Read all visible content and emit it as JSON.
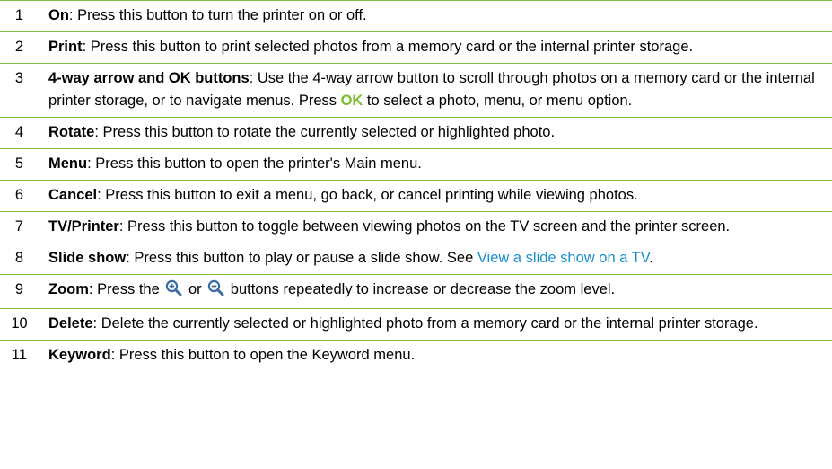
{
  "rows": [
    {
      "num": "1",
      "term": "On",
      "text": ": Press this button to turn the printer on or off."
    },
    {
      "num": "2",
      "term": "Print",
      "text": ": Press this button to print selected photos from a memory card or the internal printer storage."
    },
    {
      "num": "3",
      "term": "4-way arrow and OK buttons",
      "text_a": ": Use the 4-way arrow button to scroll through photos on a memory card or the internal printer storage, or to navigate menus. Press ",
      "ok": "OK",
      "text_b": " to select a photo, menu, or menu option."
    },
    {
      "num": "4",
      "term": "Rotate",
      "text": ": Press this button to rotate the currently selected or highlighted photo."
    },
    {
      "num": "5",
      "term": "Menu",
      "text": ": Press this button to open the printer's Main menu."
    },
    {
      "num": "6",
      "term": "Cancel",
      "text": ": Press this button to exit a menu, go back, or cancel printing while viewing photos."
    },
    {
      "num": "7",
      "term": "TV/Printer",
      "text": ": Press this button to toggle between viewing photos on the TV screen and the printer screen."
    },
    {
      "num": "8",
      "term": "Slide show",
      "text": ": Press this button to play or pause a slide show. See ",
      "link": "View a slide show on a TV",
      "text_after": "."
    },
    {
      "num": "9",
      "term": "Zoom",
      "text_a": ": Press the ",
      "mid": " or ",
      "text_b": " buttons repeatedly to increase or decrease the zoom level.",
      "icon_in": "zoom-in-icon",
      "icon_out": "zoom-out-icon"
    },
    {
      "num": "10",
      "term": "Delete",
      "text": ": Delete the currently selected or highlighted photo from a memory card or the internal printer storage."
    },
    {
      "num": "11",
      "term": "Keyword",
      "text": ": Press this button to open the Keyword menu."
    }
  ],
  "colors": {
    "rule": "#7fbf3f",
    "ok_text": "#7bbd2e",
    "link": "#1a8fd0"
  }
}
